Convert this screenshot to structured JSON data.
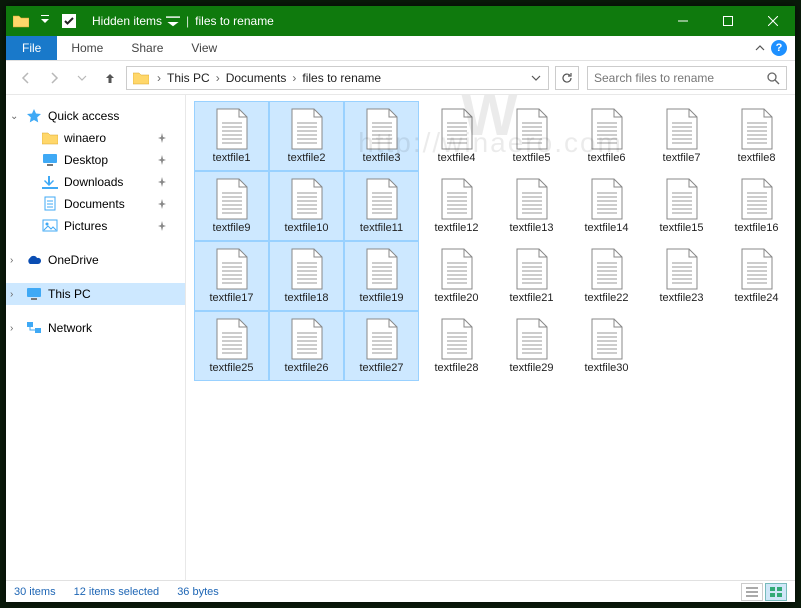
{
  "titlebar": {
    "hidden_items_label": "Hidden items",
    "window_title": "files to rename"
  },
  "ribbon": {
    "file_label": "File",
    "tabs": [
      "Home",
      "Share",
      "View"
    ]
  },
  "breadcrumb": {
    "parts": [
      "This PC",
      "Documents",
      "files to rename"
    ]
  },
  "search": {
    "placeholder": "Search files to rename"
  },
  "sidebar": {
    "quick_access": {
      "label": "Quick access",
      "items": [
        {
          "label": "winaero",
          "icon": "folder"
        },
        {
          "label": "Desktop",
          "icon": "desktop"
        },
        {
          "label": "Downloads",
          "icon": "downloads"
        },
        {
          "label": "Documents",
          "icon": "documents"
        },
        {
          "label": "Pictures",
          "icon": "pictures"
        }
      ]
    },
    "onedrive_label": "OneDrive",
    "thispc_label": "This PC",
    "network_label": "Network"
  },
  "files": [
    {
      "name": "textfile1",
      "selected": true
    },
    {
      "name": "textfile2",
      "selected": true
    },
    {
      "name": "textfile3",
      "selected": true
    },
    {
      "name": "textfile4",
      "selected": false
    },
    {
      "name": "textfile5",
      "selected": false
    },
    {
      "name": "textfile6",
      "selected": false
    },
    {
      "name": "textfile7",
      "selected": false
    },
    {
      "name": "textfile8",
      "selected": false
    },
    {
      "name": "textfile9",
      "selected": true
    },
    {
      "name": "textfile10",
      "selected": true
    },
    {
      "name": "textfile11",
      "selected": true
    },
    {
      "name": "textfile12",
      "selected": false
    },
    {
      "name": "textfile13",
      "selected": false
    },
    {
      "name": "textfile14",
      "selected": false
    },
    {
      "name": "textfile15",
      "selected": false
    },
    {
      "name": "textfile16",
      "selected": false
    },
    {
      "name": "textfile17",
      "selected": true
    },
    {
      "name": "textfile18",
      "selected": true
    },
    {
      "name": "textfile19",
      "selected": true
    },
    {
      "name": "textfile20",
      "selected": false
    },
    {
      "name": "textfile21",
      "selected": false
    },
    {
      "name": "textfile22",
      "selected": false
    },
    {
      "name": "textfile23",
      "selected": false
    },
    {
      "name": "textfile24",
      "selected": false
    },
    {
      "name": "textfile25",
      "selected": true
    },
    {
      "name": "textfile26",
      "selected": true
    },
    {
      "name": "textfile27",
      "selected": true
    },
    {
      "name": "textfile28",
      "selected": false
    },
    {
      "name": "textfile29",
      "selected": false
    },
    {
      "name": "textfile30",
      "selected": false
    }
  ],
  "statusbar": {
    "count": "30 items",
    "selected": "12 items selected",
    "size": "36 bytes"
  },
  "watermark": {
    "logo": "W",
    "url": "http://winaero.com"
  }
}
